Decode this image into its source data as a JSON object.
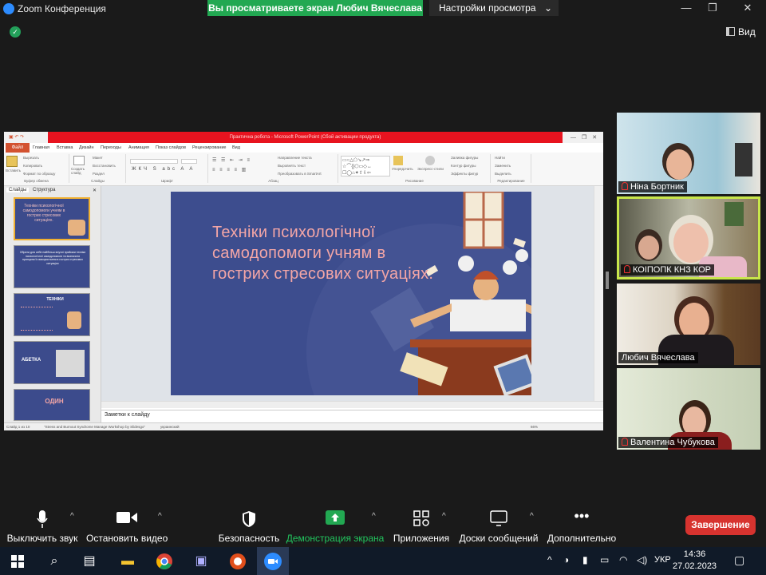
{
  "window": {
    "title": "Zoom Конференция",
    "share_banner": "Вы просматриваете экран Любич Вячеслава",
    "view_options": "Настройки просмотра",
    "view_button": "Вид"
  },
  "shared_app": {
    "title_bar": "Практична робота - Microsoft PowerPoint (Сбой активации продукта)",
    "file_tab": "Файл",
    "tabs": [
      "Главная",
      "Вставка",
      "Дизайн",
      "Переходы",
      "Анимация",
      "Показ слайдов",
      "Рецензирование",
      "Вид"
    ],
    "ribbon_groups": [
      "Буфер обмена",
      "Слайды",
      "Шрифт",
      "Абзац",
      "Рисование",
      "Редактирование"
    ],
    "ribbon_labels": {
      "paste": "Вставить",
      "cut": "Вырезать",
      "copy": "Копировать",
      "format_painter": "Формат по образцу",
      "new_slide": "Создать слайд",
      "layout": "Макет",
      "reset": "Восстановить",
      "section": "Раздел",
      "text_direction": "Направление текста",
      "align_text": "Выровнять текст",
      "smartart": "Преобразовать в SmartArt",
      "arrange": "Упорядочить",
      "quick_styles": "Экспресс-стили",
      "shape_fill": "Заливка фигуры",
      "shape_outline": "Контур фигуры",
      "shape_effects": "Эффекты фигур",
      "find": "Найти",
      "replace": "Заменить",
      "select": "Выделить"
    },
    "pane_tabs": [
      "Слайды",
      "Структура"
    ],
    "thumbnails": [
      {
        "num": "1",
        "text": "Техніки психологічної самодопомоги учням в гострих стресових ситуаціях."
      },
      {
        "num": "2",
        "text": "Обрати для себе найбільш влучні прийоми техніки психологічної самодопомоги та визначити принципи їх використання в гострих стресових ситуаціях"
      },
      {
        "num": "3",
        "text": "ТЕХНІКИ"
      },
      {
        "num": "4",
        "text": "АБЕТКА"
      },
      {
        "num": "5",
        "text": "ОДИН"
      }
    ],
    "slide_title": "Техніки психологічної самодопомоги учням в гострих стресових ситуаціях.",
    "notes_placeholder": "Заметки к слайду",
    "status": {
      "slide_counter": "Слайд 1 из 10",
      "theme": "\"Stress and Burnout Syndrome Manage Workshop by Slidesgo\"",
      "language": "украинский",
      "zoom": "66%"
    }
  },
  "participants": [
    {
      "name": "Ніна Бортник",
      "muted": true,
      "active": false
    },
    {
      "name": "КОІПОПК КНЗ КОР",
      "muted": true,
      "active": true
    },
    {
      "name": "Любич Вячеслава",
      "muted": false,
      "active": false
    },
    {
      "name": "Валентина Чубукова",
      "muted": true,
      "active": false
    }
  ],
  "toolbar": {
    "mute": "Выключить звук",
    "video": "Остановить видео",
    "security": "Безопасность",
    "share": "Демонстрация экрана",
    "apps": "Приложения",
    "whiteboards": "Доски сообщений",
    "more": "Дополнительно",
    "end": "Завершение"
  },
  "taskbar": {
    "time": "14:36",
    "date": "27.02.2023",
    "language": "УКР"
  },
  "colors": {
    "share_green": "#22a852",
    "end_red": "#d7332f",
    "active_speaker": "#c8e64b",
    "slide_bg": "#3d4d8e",
    "slide_title": "#f4a6a6"
  }
}
